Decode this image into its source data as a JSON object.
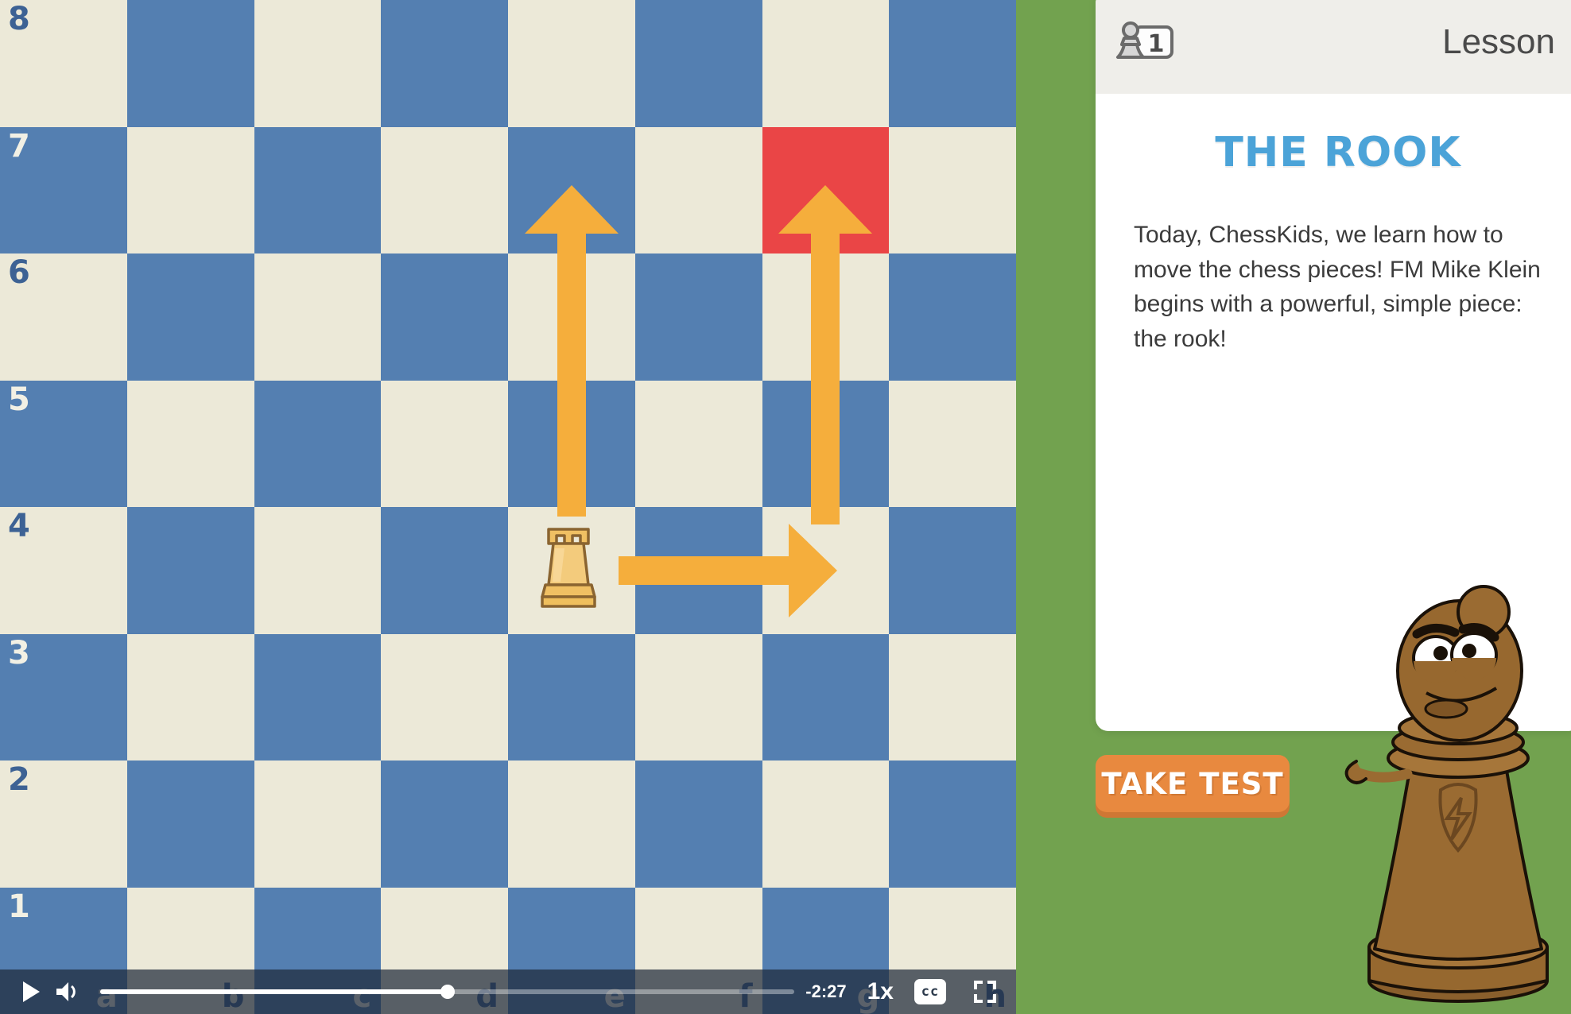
{
  "app": {
    "accent_green": "#72a24f",
    "accent_blue": "#4ba3d8",
    "accent_orange": "#e8893f",
    "board_light": "#ece9d8",
    "board_dark": "#547fb1",
    "highlight_red": "#ea4546",
    "arrow_color": "#f5ae3c"
  },
  "board": {
    "rank_labels": [
      "8",
      "7",
      "6",
      "5",
      "4",
      "3",
      "2",
      "1"
    ],
    "file_labels": [
      "a",
      "b",
      "c",
      "d",
      "e",
      "f",
      "g",
      "h"
    ],
    "piece": {
      "type": "rook",
      "color": "white",
      "square": "e4"
    },
    "highlighted_square": "g7",
    "move_arrows": [
      {
        "from": "e4",
        "to": "e7",
        "direction": "up"
      },
      {
        "from": "g4",
        "to": "g7",
        "direction": "up"
      },
      {
        "from": "e4",
        "to": "g4",
        "direction": "right"
      }
    ]
  },
  "video_controls": {
    "play_label": "play-icon",
    "volume_label": "volume-icon",
    "time_remaining": "-2:27",
    "speed": "1x",
    "cc_label": "cc",
    "fullscreen_label": "fullscreen-icon",
    "progress_percent": 50
  },
  "lesson_card": {
    "header": {
      "badge_number": "1",
      "title": "Lesson"
    },
    "title": "The Rook",
    "body": "Today, ChessKids, we learn how to move the chess pieces! FM Mike Klein begins with a powerful, simple piece: the rook!"
  },
  "take_test": {
    "label": "Take Test"
  },
  "mascot": {
    "name": "chess-pawn-mascot"
  }
}
